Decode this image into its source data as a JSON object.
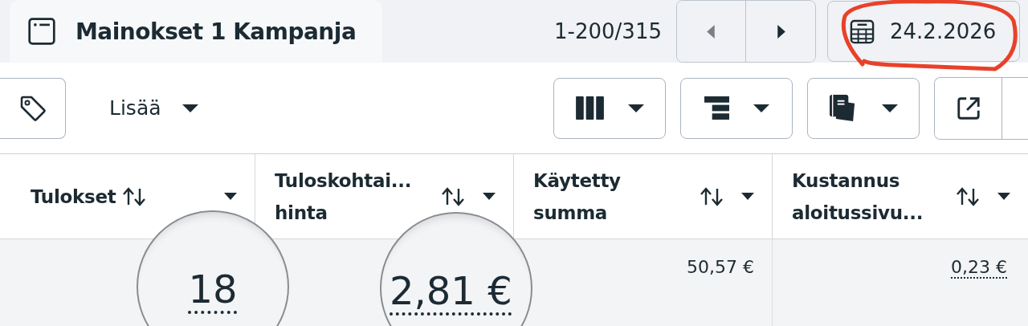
{
  "tab": {
    "title": "Mainokset 1 Kampanja"
  },
  "pagination": {
    "range": "1-200/315",
    "prev_disabled": true,
    "next_disabled": false
  },
  "date_button": {
    "label": "24.2.2026",
    "annotated": true
  },
  "toolbar": {
    "more_label": "Lisää"
  },
  "table": {
    "columns": [
      {
        "label_lines": [
          "Tulokset"
        ],
        "value": "18",
        "magnified": true,
        "underlined": true
      },
      {
        "label_lines": [
          "Tuloskohtai...",
          "hinta"
        ],
        "value": "2,81 €",
        "magnified": true,
        "underlined": true
      },
      {
        "label_lines": [
          "Käytetty",
          "summa"
        ],
        "value": "50,57 €",
        "magnified": false,
        "underlined": false
      },
      {
        "label_lines": [
          "Kustannus",
          "aloitussivu..."
        ],
        "value": "0,23 €",
        "magnified": false,
        "underlined": true
      }
    ]
  }
}
